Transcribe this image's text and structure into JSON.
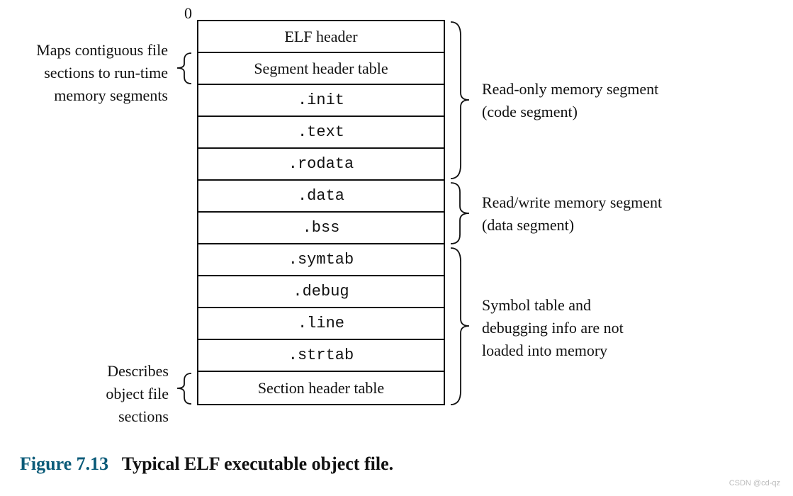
{
  "zero": "0",
  "rows": [
    {
      "label": "ELF header",
      "mono": false
    },
    {
      "label": "Segment header table",
      "mono": false
    },
    {
      "label": ".init",
      "mono": true
    },
    {
      "label": ".text",
      "mono": true
    },
    {
      "label": ".rodata",
      "mono": true
    },
    {
      "label": ".data",
      "mono": true
    },
    {
      "label": ".bss",
      "mono": true
    },
    {
      "label": ".symtab",
      "mono": true
    },
    {
      "label": ".debug",
      "mono": true
    },
    {
      "label": ".line",
      "mono": true
    },
    {
      "label": ".strtab",
      "mono": true
    },
    {
      "label": "Section header table",
      "mono": false
    }
  ],
  "left_annotations": {
    "a0": {
      "line1": "Maps contiguous file",
      "line2": "sections to run-time",
      "line3": "memory segments"
    },
    "a1": {
      "line1": "Describes",
      "line2": "object file",
      "line3": "sections"
    }
  },
  "right_annotations": {
    "r0": {
      "line1": "Read-only memory segment",
      "line2": "(code segment)"
    },
    "r1": {
      "line1": "Read/write memory segment",
      "line2": "(data segment)"
    },
    "r2": {
      "line1": "Symbol table and",
      "line2": "debugging info are not",
      "line3": "loaded into memory"
    }
  },
  "caption": {
    "label": "Figure 7.13",
    "title": "Typical ELF executable object file."
  },
  "watermark": "CSDN @cd-qz"
}
